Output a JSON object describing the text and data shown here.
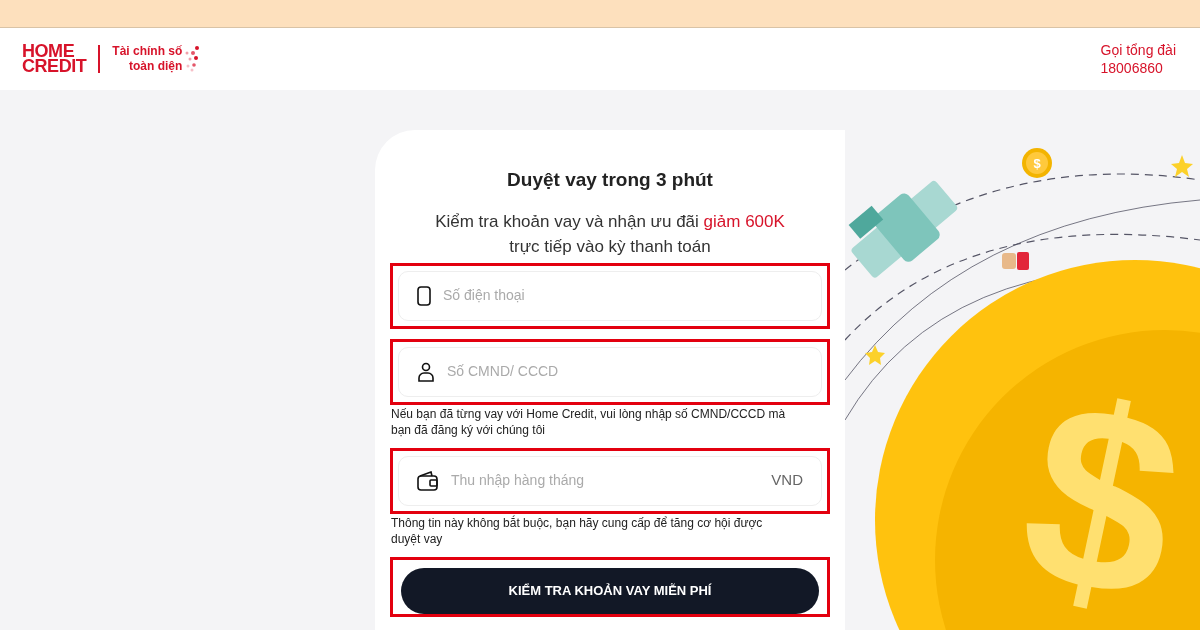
{
  "header": {
    "logo": {
      "line1": "HOME",
      "line2": "CREDIT"
    },
    "tagline": {
      "line1": "Tài chính số",
      "line2": "toàn diện"
    },
    "hotline": {
      "label": "Gọi tổng đài",
      "number": "18006860"
    }
  },
  "form": {
    "title": "Duyệt vay trong 3 phút",
    "subtitle": "Kiểm tra khoản vay và nhận ưu đãi **giảm 600K** trực tiếp vào kỳ thanh toán",
    "fields": [
      {
        "kind": "phone",
        "placeholder": "Số điện thoại",
        "highlighted": true
      },
      {
        "kind": "id",
        "placeholder": "Số CMND/ CCCD",
        "highlighted": true,
        "hint": "Nếu bạn đã từng vay với Home Credit, vui lòng nhập số CMND/CCCD mà bạn đã đăng ký với chúng tôi"
      },
      {
        "kind": "income",
        "placeholder": "Thu nhập hàng tháng",
        "suffix": "VND",
        "highlighted": true,
        "hint": "Thông tin này không bắt buộc, bạn hãy cung cấp để tăng cơ hội được duyệt vay"
      }
    ],
    "submit": {
      "label": "KIỂM TRA KHOẢN VAY MIỄN PHÍ",
      "highlighted": true
    }
  },
  "illustration": {
    "small_coin_symbol": "$",
    "big_coin_symbol": "$"
  }
}
